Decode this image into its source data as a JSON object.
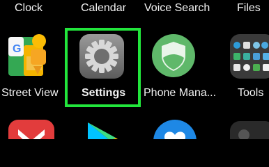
{
  "top_row": {
    "clock_label": "Clock",
    "calendar_label": "Calendar",
    "voice_search_label": "Voice Search",
    "files_label": "Files"
  },
  "middle_row": {
    "street_view_label": "Street View",
    "settings_label": "Settings",
    "phone_manager_label": "Phone Mana...",
    "tools_label": "Tools"
  },
  "highlight": {
    "color": "#22e63c",
    "target": "Settings"
  },
  "icons": {
    "street_view": "street-view-icon",
    "settings": "settings-gear-icon",
    "phone_manager": "phone-manager-shield-icon",
    "tools": "tools-folder-icon",
    "bottom_left": "wps-office-icon",
    "bottom_center": "play-store-icon",
    "bottom_right": "health-heart-icon"
  }
}
